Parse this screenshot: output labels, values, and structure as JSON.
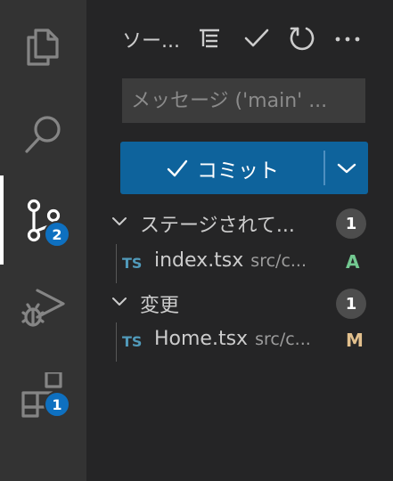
{
  "activity_bar": {
    "scm_badge": "2",
    "extensions_badge": "1"
  },
  "scm": {
    "title": "ソー...",
    "commit_message_placeholder": "メッセージ ('main' ...",
    "commit_label": "コミット",
    "staged": {
      "label": "ステージされて...",
      "count": "1",
      "files": [
        {
          "icon": "TS",
          "name": "index.tsx",
          "path": "src/c...",
          "status": "A",
          "status_color": "#73c991"
        }
      ]
    },
    "changes": {
      "label": "変更",
      "count": "1",
      "files": [
        {
          "icon": "TS",
          "name": "Home.tsx",
          "path": "src/c...",
          "status": "M",
          "status_color": "#e2c08d"
        }
      ]
    }
  },
  "colors": {
    "accent": "#0e639c",
    "badge": "#0e70c0",
    "activity_bar_bg": "#333333",
    "sidebar_bg": "#252526"
  }
}
